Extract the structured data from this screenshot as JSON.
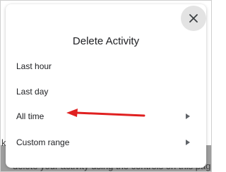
{
  "backdrop": {
    "left_char": "k",
    "bottom_text": "delete your activity using the controls on this page"
  },
  "dialog": {
    "title": "Delete Activity",
    "close_icon": "close-icon",
    "options": [
      {
        "label": "Last hour",
        "has_submenu": false
      },
      {
        "label": "Last day",
        "has_submenu": false
      },
      {
        "label": "All time",
        "has_submenu": true
      },
      {
        "label": "Custom range",
        "has_submenu": true
      }
    ]
  },
  "annotation": {
    "type": "red-arrow",
    "color": "#e02020",
    "points_to": "All time"
  }
}
